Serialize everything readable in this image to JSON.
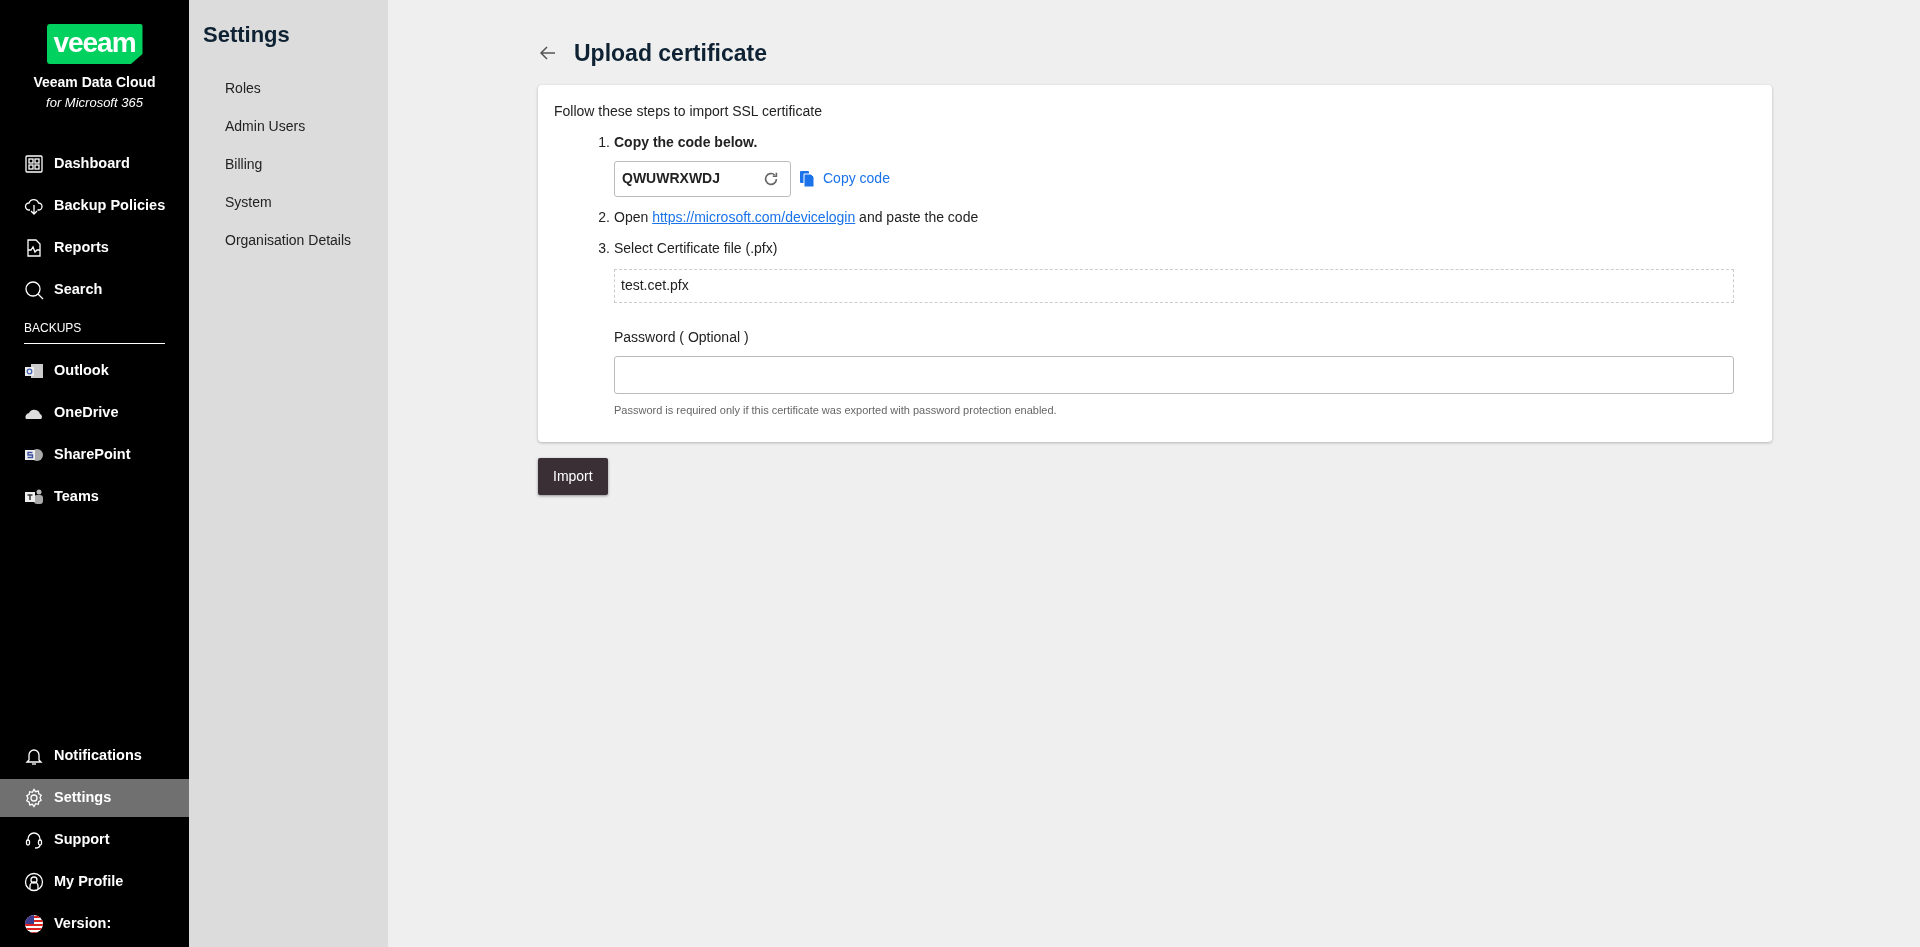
{
  "sidebar": {
    "logo": "veeam",
    "product": "Veeam Data Cloud",
    "subtitle": "for Microsoft 365",
    "nav": [
      {
        "label": "Dashboard",
        "selected": false
      },
      {
        "label": "Backup Policies",
        "selected": false
      },
      {
        "label": "Reports",
        "selected": false
      },
      {
        "label": "Search",
        "selected": false
      }
    ],
    "section": "BACKUPS",
    "backups": [
      {
        "label": "Outlook",
        "selected": false
      },
      {
        "label": "OneDrive",
        "selected": false
      },
      {
        "label": "SharePoint",
        "selected": false
      },
      {
        "label": "Teams",
        "selected": false
      }
    ],
    "bottom": [
      {
        "label": "Notifications",
        "selected": false
      },
      {
        "label": "Settings",
        "selected": true
      },
      {
        "label": "Support",
        "selected": false
      },
      {
        "label": "My Profile",
        "selected": false
      },
      {
        "label": "Version:",
        "selected": false
      }
    ]
  },
  "settings_menu": {
    "title": "Settings",
    "items": [
      "Roles",
      "Admin Users",
      "Billing",
      "System",
      "Organisation Details"
    ]
  },
  "page": {
    "title": "Upload certificate",
    "intro": "Follow these steps to import SSL certificate",
    "step1": {
      "number": "1.",
      "label": "Copy the code below.",
      "code": "QWUWRXWDJ",
      "copy_label": "Copy code"
    },
    "step2": {
      "number": "2.",
      "before": "Open ",
      "link": "https://microsoft.com/devicelogin",
      "after": " and paste the code"
    },
    "step3": {
      "number": "3.",
      "label": "Select Certificate file (.pfx)",
      "file": "test.cet.pfx",
      "password_label": "Password ( Optional )",
      "password_help": "Password is required only if this certificate was exported with password protection enabled."
    },
    "button": "Import"
  }
}
